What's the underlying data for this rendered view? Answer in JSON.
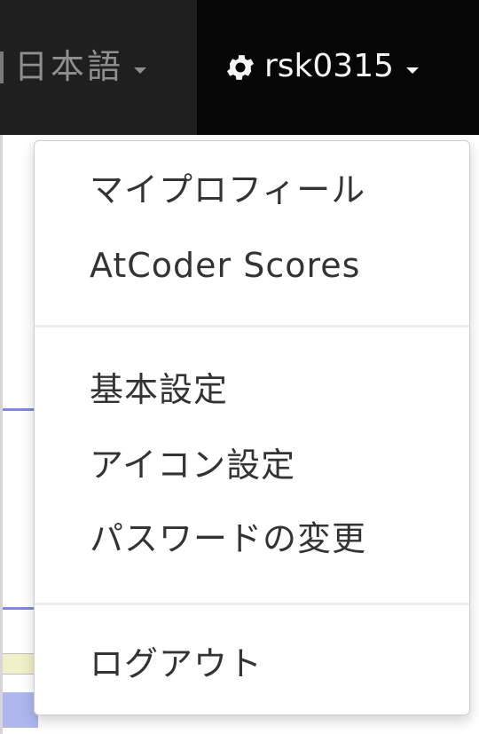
{
  "navbar": {
    "language": {
      "label": "日本語",
      "icon": "chevron-down-icon"
    },
    "user": {
      "icon": "gear-icon",
      "username": "rsk0315",
      "caret_icon": "chevron-down-icon"
    }
  },
  "dropdown": {
    "groups": [
      {
        "items": [
          {
            "label": "マイプロフィール"
          },
          {
            "label": "AtCoder Scores"
          }
        ]
      },
      {
        "items": [
          {
            "label": "基本設定"
          },
          {
            "label": "アイコン設定"
          },
          {
            "label": "パスワードの変更"
          }
        ]
      },
      {
        "items": [
          {
            "label": "ログアウト"
          }
        ]
      }
    ]
  },
  "colors": {
    "navbar_bg": "#060606",
    "lang_bg": "#1f1f1f",
    "menu_text": "#333333",
    "divider": "#ececec",
    "page_line": "#7f86e6",
    "page_cell": "#eef0c7"
  }
}
